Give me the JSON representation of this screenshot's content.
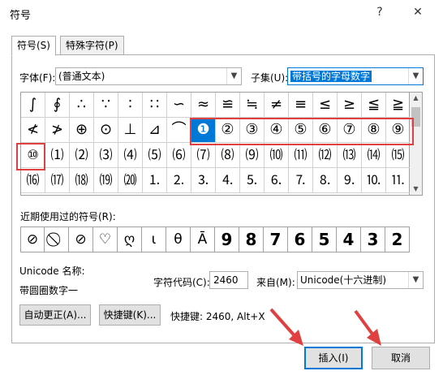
{
  "dialog": {
    "title": "符号",
    "help_icon": "?",
    "close_icon": "✕"
  },
  "tabs": [
    {
      "label": "符号(S)"
    },
    {
      "label": "特殊字符(P)"
    }
  ],
  "font": {
    "label": "字体(F):",
    "value": "(普通文本)"
  },
  "subset": {
    "label": "子集(U):",
    "value": "带括号的字母数字"
  },
  "symbol_grid": {
    "rows": [
      [
        "∫",
        "∮",
        "∴",
        "∵",
        "∶",
        "∷",
        "∽",
        "≈",
        "≌",
        "≒",
        "≠",
        "≡",
        "≤",
        "≥",
        "≦",
        "≧"
      ],
      [
        "≮",
        "≯",
        "⊕",
        "⊙",
        "⊥",
        "⊿",
        "⌒",
        "❶",
        "②",
        "③",
        "④",
        "⑤",
        "⑥",
        "⑦",
        "⑧",
        "⑨"
      ],
      [
        "⑩",
        "⑴",
        "⑵",
        "⑶",
        "⑷",
        "⑸",
        "⑹",
        "⑺",
        "⑻",
        "⑼",
        "⑽",
        "⑾",
        "⑿",
        "⒀",
        "⒁",
        "⒂"
      ],
      [
        "⒃",
        "⒄",
        "⒅",
        "⒆",
        "⒇",
        "⒈",
        "⒉",
        "⒊",
        "⒋",
        "⒌",
        "⒍",
        "⒎",
        "⒏",
        "⒐",
        "⒑",
        "⒒"
      ]
    ],
    "selected": "❶"
  },
  "recent": {
    "label": "近期使用过的符号(R):",
    "symbols": [
      "⊘",
      "⃠",
      "⊘",
      "♡",
      "ღ",
      "ι",
      "θ",
      "Ā",
      "9",
      "8",
      "7",
      "6",
      "5",
      "4",
      "3",
      "2"
    ]
  },
  "unicode_name": {
    "label": "Unicode 名称:",
    "value": "带圆圈数字一"
  },
  "char_code": {
    "label": "字符代码(C):",
    "value": "2460"
  },
  "from": {
    "label": "来自(M):",
    "value": "Unicode(十六进制)"
  },
  "buttons": {
    "autocorrect": "自动更正(A)...",
    "shortcut": "快捷键(K)...",
    "insert": "插入(I)",
    "cancel": "取消"
  },
  "shortcut_text": "快捷键: 2460, Alt+X",
  "colors": {
    "accent": "#0078d7",
    "highlight": "#e04040"
  }
}
